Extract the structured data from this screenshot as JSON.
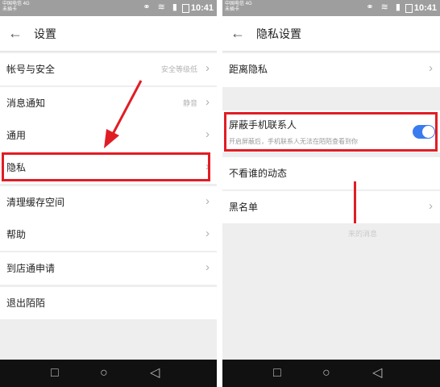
{
  "status_bar": {
    "carrier": "中国电信 4G",
    "carrier_sub": "未插卡",
    "time": "10:41"
  },
  "left_screen": {
    "title": "设置",
    "items": [
      {
        "label": "帐号与安全",
        "hint": "安全等级低"
      },
      {
        "label": "消息通知",
        "hint": "静音"
      },
      {
        "label": "通用",
        "hint": ""
      },
      {
        "label": "隐私",
        "hint": ""
      },
      {
        "label": "清理缓存空间",
        "hint": ""
      },
      {
        "label": "帮助",
        "hint": ""
      },
      {
        "label": "到店通申请",
        "hint": ""
      },
      {
        "label": "退出陌陌",
        "hint": ""
      }
    ]
  },
  "right_screen": {
    "title": "隐私设置",
    "items": [
      {
        "label": "距离隐私"
      },
      {
        "label": "屏蔽手机联系人",
        "sub": "开启屏蔽后，手机联系人无法在陌陌查看到你",
        "toggle_on": true
      },
      {
        "label": "不看谁的动态"
      },
      {
        "label": "黑名单"
      }
    ],
    "faint_text": "来的消息"
  },
  "colors": {
    "highlight": "#e11d24",
    "toggle": "#3a7bf0",
    "status_bar": "#9e9e9e"
  }
}
